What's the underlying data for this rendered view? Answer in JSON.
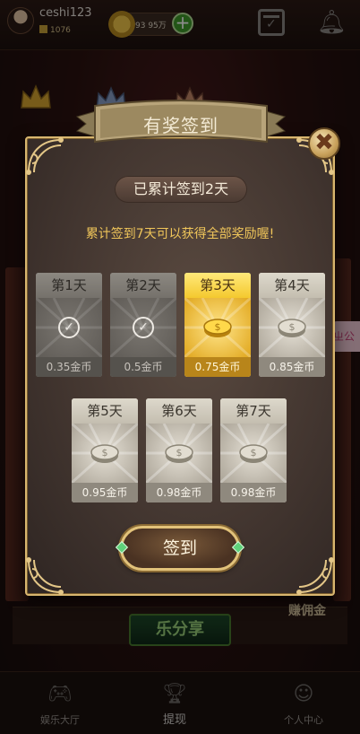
{
  "topbar": {
    "username": "ceshi123",
    "user_coins": "1076",
    "balance": "93 95万"
  },
  "bg": {
    "share_label": "乐分享",
    "commission_label": "赚佣金",
    "side_tab_label": "ㄓ公"
  },
  "bottom_nav": [
    {
      "label": "娱乐大厅",
      "icon": "gamepad-icon"
    },
    {
      "label": "提现",
      "icon": "trophy-icon"
    },
    {
      "label": "个人中心",
      "icon": "person-icon"
    }
  ],
  "dialog": {
    "title": "有奖签到",
    "streak": "已累计签到2天",
    "hint": "累计签到7天可以获得全部奖励喔!",
    "button": "签到",
    "days": [
      {
        "label": "第1天",
        "reward": "0.35金币",
        "state": "done"
      },
      {
        "label": "第2天",
        "reward": "0.5金币",
        "state": "done"
      },
      {
        "label": "第3天",
        "reward": "0.75金币",
        "state": "today"
      },
      {
        "label": "第4天",
        "reward": "0.85金币",
        "state": "future"
      },
      {
        "label": "第5天",
        "reward": "0.95金币",
        "state": "future"
      },
      {
        "label": "第6天",
        "reward": "0.98金币",
        "state": "future"
      },
      {
        "label": "第7天",
        "reward": "0.98金币",
        "state": "future"
      }
    ]
  },
  "colors": {
    "gold": "#d8b66f",
    "today": "#e4b428",
    "hint": "#f0c65a"
  }
}
